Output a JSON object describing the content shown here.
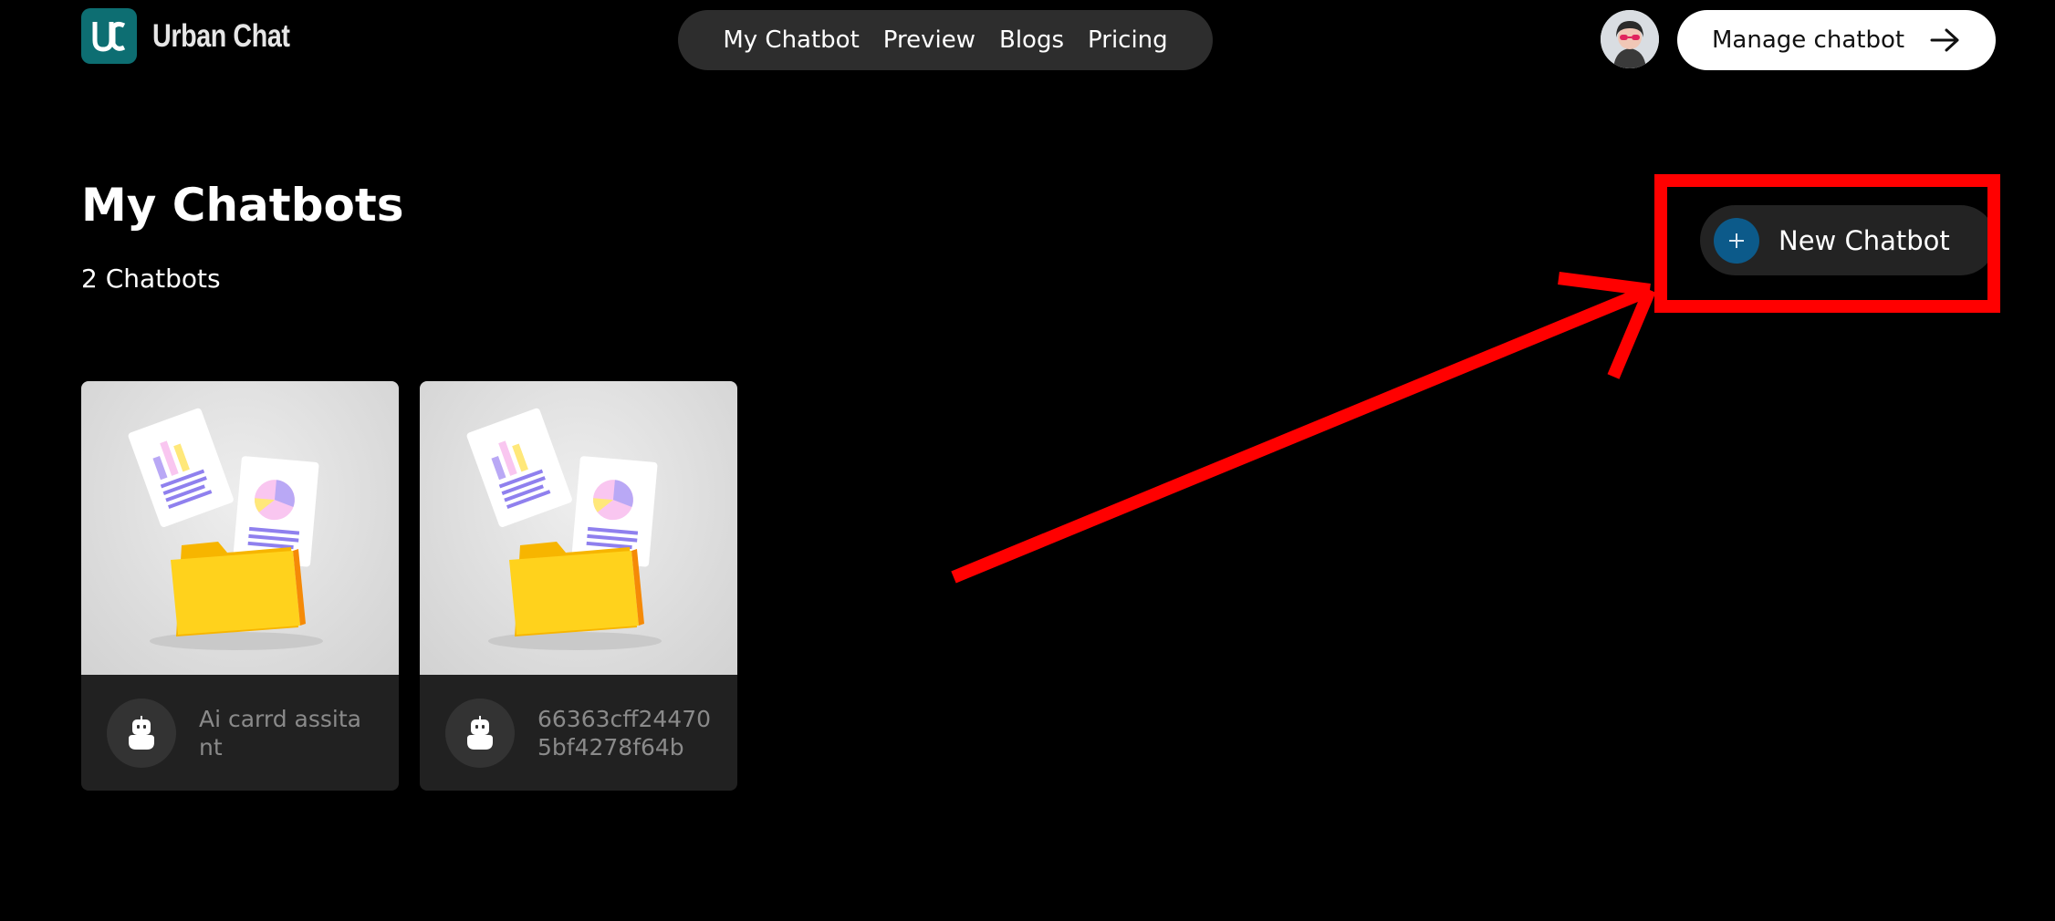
{
  "brand": {
    "name": "Urban Chat"
  },
  "nav": {
    "items": [
      {
        "label": "My Chatbot"
      },
      {
        "label": "Preview"
      },
      {
        "label": "Blogs"
      },
      {
        "label": "Pricing"
      }
    ]
  },
  "header": {
    "manage_label": "Manage chatbot",
    "manage_icon": "arrow-right-icon",
    "avatar_icon": "user-avatar"
  },
  "main": {
    "title": "My Chatbots",
    "count": "2 Chatbots",
    "new_button_label": "New Chatbot",
    "new_button_icon": "plus-icon"
  },
  "cards": [
    {
      "name": "Ai carrd assita nt",
      "icon": "robot-icon",
      "thumbnail": "documents-folder-illustration"
    },
    {
      "name": "66363cff244705bf4278f64b",
      "icon": "robot-icon",
      "thumbnail": "documents-folder-illustration"
    }
  ],
  "annotation": {
    "color": "#ff0000",
    "type": "highlight-box-and-arrow"
  },
  "colors": {
    "background": "#000000",
    "nav_bg": "#2d2d2d",
    "card_bg": "#212121",
    "accent_blue": "#0c5a8a",
    "brand_teal": "#0d6e72"
  }
}
